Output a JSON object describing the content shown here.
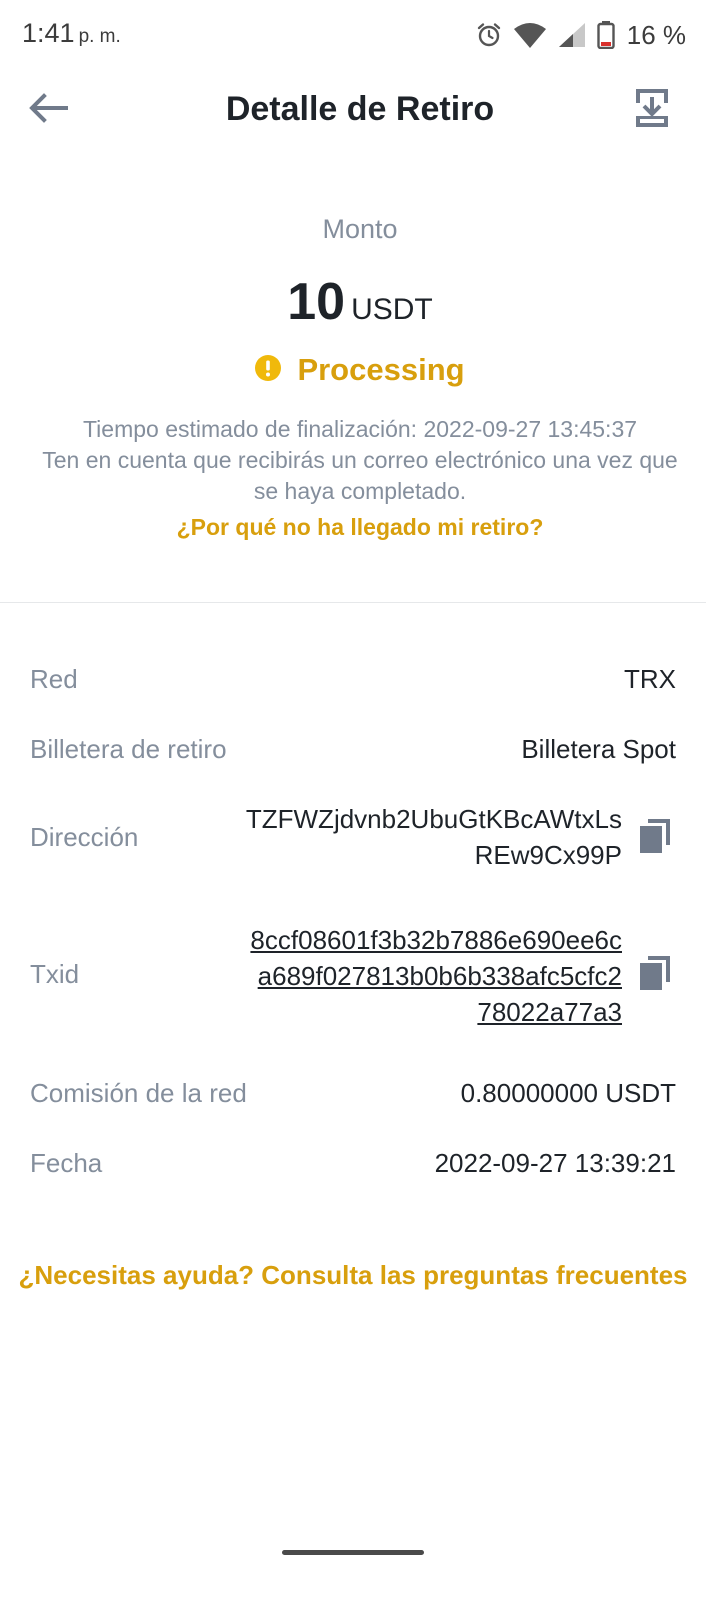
{
  "status_bar": {
    "time": "1:41",
    "ampm": "p. m.",
    "battery": "16 %"
  },
  "header": {
    "title": "Detalle de Retiro"
  },
  "amount": {
    "label": "Monto",
    "value": "10",
    "unit": "USDT"
  },
  "status": {
    "text": "Processing",
    "color": "#d89f0d"
  },
  "info": {
    "line1": "Tiempo estimado de finalización: 2022-09-27 13:45:37",
    "line2": "Ten en cuenta que recibirás un correo electrónico una vez que se haya completado.",
    "why_link": "¿Por qué no ha llegado mi retiro?"
  },
  "details": {
    "network_label": "Red",
    "network_value": "TRX",
    "wallet_label": "Billetera de retiro",
    "wallet_value": "Billetera Spot",
    "address_label": "Dirección",
    "address_line1": "TZFWZjdvnb2UbuGtKBcAWtxLs",
    "address_line2": "REw9Cx99P",
    "txid_label": "Txid",
    "txid_line1": "8ccf08601f3b32b7886e690ee6c",
    "txid_line2": "a689f027813b0b6b338afc5cfc2",
    "txid_line3": "78022a77a3",
    "fee_label": "Comisión de la red",
    "fee_value": "0.80000000 USDT",
    "date_label": "Fecha",
    "date_value": "2022-09-27 13:39:21"
  },
  "help": {
    "text": "¿Necesitas ayuda? Consulta las preguntas frecuentes"
  }
}
